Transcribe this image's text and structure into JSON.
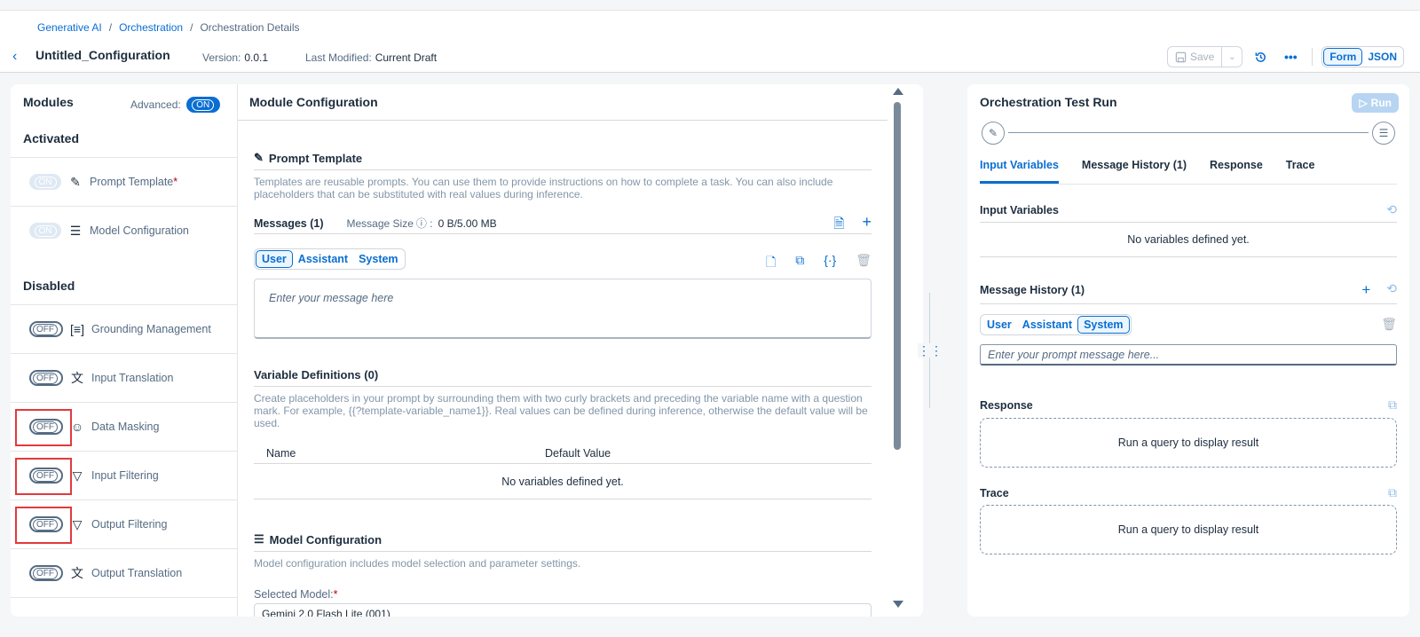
{
  "breadcrumb": [
    "Generative AI",
    "Orchestration",
    "Orchestration Details"
  ],
  "page": {
    "title": "Untitled_Configuration",
    "version_label": "Version:",
    "version_value": "0.0.1",
    "modified_label": "Last Modified:",
    "modified_value": "Current Draft"
  },
  "toolbar": {
    "save_label": "Save",
    "view_form": "Form",
    "view_json": "JSON"
  },
  "modules": {
    "title": "Modules",
    "advanced_label": "Advanced:",
    "advanced_state": "ON",
    "activated_label": "Activated",
    "disabled_label": "Disabled",
    "activated": [
      {
        "state": "ON",
        "icon": "prompt-template-icon",
        "label": "Prompt Template",
        "required": "*"
      },
      {
        "state": "ON",
        "icon": "model-config-icon",
        "label": "Model Configuration"
      }
    ],
    "disabled": [
      {
        "state": "OFF",
        "icon": "grounding-icon",
        "label": "Grounding Management"
      },
      {
        "state": "OFF",
        "icon": "translate-icon",
        "label": "Input Translation"
      },
      {
        "state": "OFF",
        "icon": "mask-icon",
        "label": "Data Masking"
      },
      {
        "state": "OFF",
        "icon": "filter-icon",
        "label": "Input Filtering"
      },
      {
        "state": "OFF",
        "icon": "filter-icon",
        "label": "Output Filtering"
      },
      {
        "state": "OFF",
        "icon": "translate-icon",
        "label": "Output Translation"
      }
    ]
  },
  "config": {
    "title": "Module Configuration",
    "prompt_template": {
      "title": "Prompt Template",
      "description": "Templates are reusable prompts. You can use them to provide instructions on how to complete a task. You can also include placeholders that can be substituted with real values during inference."
    },
    "messages": {
      "title": "Messages (1)",
      "size_label": "Message Size",
      "size_value": "0 B/5.00 MB",
      "roles": [
        "User",
        "Assistant",
        "System"
      ],
      "active_role": "User",
      "placeholder": "Enter your message here"
    },
    "variables": {
      "title": "Variable Definitions (0)",
      "description": "Create placeholders in your prompt by surrounding them with two curly brackets and preceding the variable name with a question mark. For example, {{?template-variable_name1}}. Real values can be defined during inference, otherwise the default value will be used.",
      "columns": [
        "Name",
        "Default Value"
      ],
      "empty": "No variables defined yet."
    },
    "model_configuration": {
      "title": "Model Configuration",
      "description": "Model configuration includes model selection and parameter settings.",
      "selected_label": "Selected Model:",
      "selected_value": "Gemini 2.0 Flash Lite (001)"
    }
  },
  "test_run": {
    "title": "Orchestration Test Run",
    "run_label": "Run",
    "tabs": [
      "Input Variables",
      "Message History (1)",
      "Response",
      "Trace"
    ],
    "active_tab": "Input Variables",
    "input_variables": {
      "title": "Input Variables",
      "empty": "No variables defined yet."
    },
    "message_history": {
      "title": "Message History (1)",
      "roles": [
        "User",
        "Assistant",
        "System"
      ],
      "active_role": "System",
      "placeholder": "Enter your prompt message here..."
    },
    "response": {
      "title": "Response",
      "empty": "Run a query to display result"
    },
    "trace": {
      "title": "Trace",
      "empty": "Run a query to display result"
    }
  }
}
